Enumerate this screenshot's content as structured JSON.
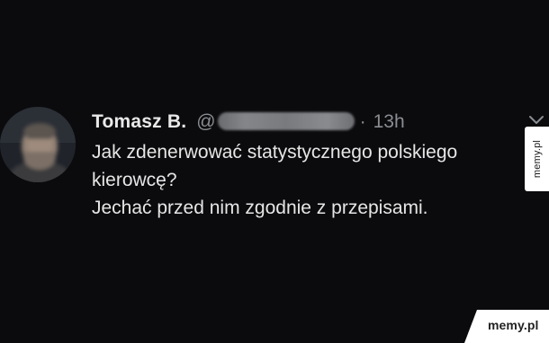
{
  "tweet": {
    "author_name": "Tomasz B.",
    "handle_prefix": "@",
    "separator": "·",
    "time": "13h",
    "text_lines": [
      "Jak zdenerwować statystycznego polskiego",
      "kierowcę?",
      "Jechać przed nim zgodnie z przepisami."
    ]
  },
  "watermark": {
    "side_label": "memy.pl",
    "corner_label": "memy.pl"
  },
  "colors": {
    "background": "#0b0b0d",
    "name": "#e9e9e9",
    "meta": "#8a8d91",
    "text": "#e6e6e6"
  },
  "icons": {
    "menu": "chevron-down-icon"
  }
}
